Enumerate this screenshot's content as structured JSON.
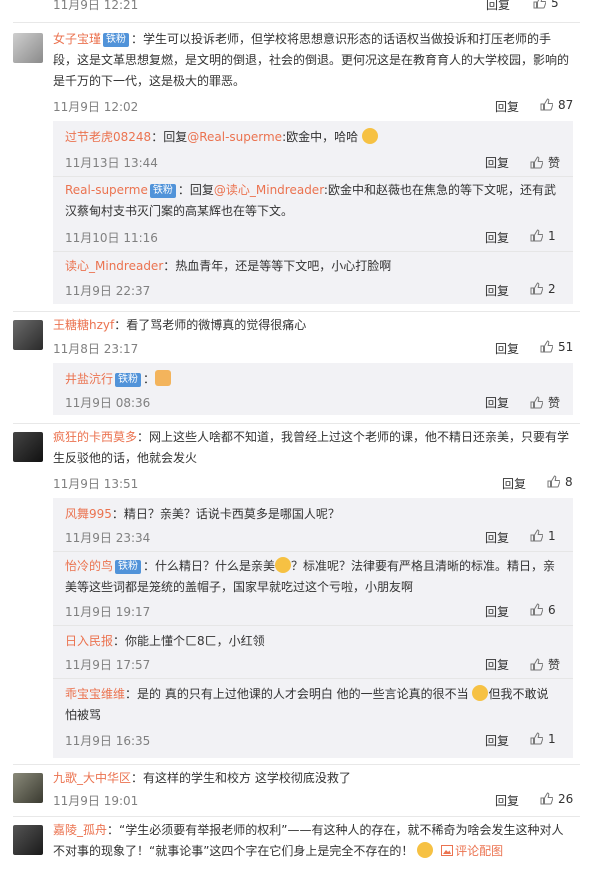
{
  "top": {
    "time": "11月9日 12:21",
    "reply": "回复",
    "likes": "5"
  },
  "comments": [
    {
      "name": "女子宝瑾",
      "badge": "铁粉",
      "text": "：学生可以投诉老师，但学校将思想意识形态的话语权当做投诉和打压老师的手段，这是文革思想复燃，是文明的倒退，社会的倒退。更何况这是在教育育人的大学校园，影响的是千万的下一代，这是极大的罪恶。",
      "time": "11月9日 12:02",
      "reply": "回复",
      "likes": "87"
    },
    {
      "name": "王糖糖hzyf",
      "text": "：看了骂老师的微博真的觉得很痛心",
      "time": "11月8日 23:17",
      "reply": "回复",
      "likes": "51"
    },
    {
      "name": "疯狂的卡西莫多",
      "text": "：网上这些人啥都不知道，我曾经上过这个老师的课，他不精日还亲美，只要有学生反驳他的话，他就会发火",
      "time": "11月9日 13:51",
      "reply": "回复",
      "likes": "8"
    },
    {
      "name": "九歌_大中华区",
      "text": "：有这样的学生和校方 这学校彻底没救了",
      "time": "11月9日 19:01",
      "reply": "回复",
      "likes": "26"
    },
    {
      "name": "嘉陵_孤舟",
      "text": "：“学生必须要有举报老师的权利”——有这种人的存在，就不稀奇为啥会发生这种对人不对事的现象了！“就事论事”这四个字在它们身上是完全不存在的！",
      "extra": "评论配图"
    }
  ],
  "subs1": [
    {
      "name": "过节老虎08248",
      "text": "：回复",
      "mention": "@Real-superme",
      "text2": ":欧金中，哈哈",
      "time": "11月13日 13:44",
      "reply": "回复",
      "likes": "赞"
    },
    {
      "name": "Real-superme",
      "badge": "铁粉",
      "text": "：回复",
      "mention": "@读心_Mindreader",
      "text2": ":欧金中和赵薇也在焦急的等下文呢，还有武汉蔡甸村支书灭门案的高某辉也在等下文。",
      "time": "11月10日 11:16",
      "reply": "回复",
      "likes": "1"
    },
    {
      "name": "读心_Mindreader",
      "text": "：热血青年，还是等等下文吧，小心打脸啊",
      "time": "11月9日 22:37",
      "reply": "回复",
      "likes": "2"
    }
  ],
  "subs2": [
    {
      "name": "井盐沆行",
      "badge": "铁粉",
      "text": "：",
      "time": "11月9日 08:36",
      "reply": "回复",
      "likes": "赞"
    }
  ],
  "subs3": [
    {
      "name": "风舞995",
      "text": "：精日？亲美？话说卡西莫多是哪国人呢？",
      "time": "11月9日 23:34",
      "reply": "回复",
      "likes": "1"
    },
    {
      "name": "怡冷的鸟",
      "badge": "铁粉",
      "text": "：什么精日？什么是亲美",
      "text2": "？标准呢？法律要有严格且清晰的标准。精日，亲美等这些词都是笼统的盖帽子，国家早就吃过这个亏啦，小朋友啊",
      "time": "11月9日 19:17",
      "reply": "回复",
      "likes": "6"
    },
    {
      "name": "日入民报",
      "text": "：你能上懂个ㄈ8ㄈ，小红领",
      "time": "11月9日 17:57",
      "reply": "回复",
      "likes": "赞"
    },
    {
      "name": "乖宝宝维维",
      "text": "：是的  真的只有上过他课的人才会明白 他的一些言论真的很不当",
      "text2": "但我不敢说 怕被骂",
      "time": "11月9日 16:35",
      "reply": "回复",
      "likes": "1"
    }
  ],
  "colors": {
    "name": "#eb7350",
    "badge": "#5193d9",
    "subbg": "#f2f2f5",
    "time": "#808080"
  },
  "icons": [
    "thumbs-up-icon",
    "emoji-icon",
    "picture-icon"
  ]
}
